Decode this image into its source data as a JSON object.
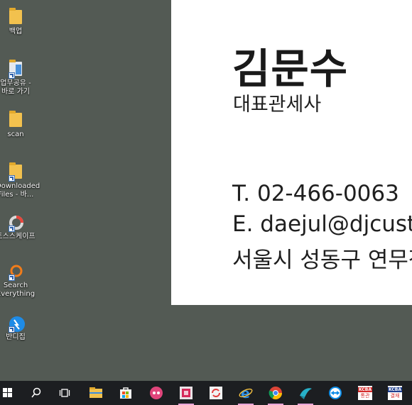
{
  "desktop": {
    "icons": [
      {
        "label": "백업",
        "icon": "folder-icon"
      },
      {
        "label": "업무공유 -\n바로 가기",
        "icon": "shared-folder-shortcut-icon"
      },
      {
        "label": "scan",
        "icon": "folder-icon"
      },
      {
        "label": "Downloaded\nFiles - 바...",
        "icon": "folder-shortcut-icon"
      },
      {
        "label": "토스스케이프",
        "icon": "tosscape-icon"
      },
      {
        "label": "Search\nEverything",
        "icon": "search-everything-icon"
      },
      {
        "label": "반디집",
        "icon": "bandizip-icon"
      }
    ]
  },
  "business_card": {
    "name": "김문수",
    "title": "대표관세사",
    "phone": "T. 02-466-0063",
    "email": "E. daejul@djcust",
    "address": "서울시 성동구 연무장"
  },
  "taskbar": {
    "items": [
      "start-icon",
      "search-icon",
      "task-view-icon",
      "file-explorer-icon",
      "microsoft-store-icon",
      "chat-bot-icon",
      "red-app-icon",
      "sync-app-icon",
      "internet-explorer-icon",
      "chrome-icon",
      "bird-app-icon",
      "teamviewer-icon",
      "kcba-app-icon-1",
      "kcba-app-icon-2"
    ],
    "kcba_label_1": "KCBA",
    "kcba_sub_1": "통관",
    "kcba_label_2": "KCBA",
    "kcba_sub_2": "결재"
  },
  "colors": {
    "desktop": "#535a54",
    "taskbar": "#1c1e21",
    "folder": "#f2c14e"
  }
}
